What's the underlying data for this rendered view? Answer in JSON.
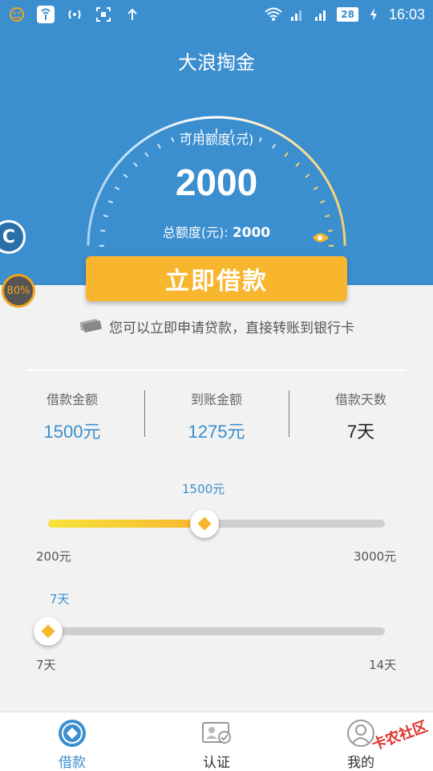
{
  "status_bar": {
    "battery": "28",
    "time": "16:03"
  },
  "header": {
    "title": "大浪掏金",
    "available_label": "可用额度(元)",
    "available_amount": "2000",
    "total_label": "总额度(元): ",
    "total_amount": "2000",
    "side_bubble": "C",
    "badge_percent": "80%"
  },
  "borrow_button": "立即借款",
  "tip": "您可以立即申请贷款，直接转账到银行卡",
  "stats": [
    {
      "label": "借款金额",
      "value": "1500元"
    },
    {
      "label": "到账金额",
      "value": "1275元"
    },
    {
      "label": "借款天数",
      "value": "7天"
    }
  ],
  "amount_slider": {
    "current": "1500元",
    "min": "200元",
    "max": "3000元",
    "value": 1500,
    "range": [
      200,
      3000
    ]
  },
  "days_slider": {
    "current": "7天",
    "min": "7天",
    "max": "14天",
    "value": 7,
    "range": [
      7,
      14
    ]
  },
  "bottom_nav": [
    {
      "label": "借款",
      "icon": "loan-icon",
      "active": true
    },
    {
      "label": "认证",
      "icon": "id-card-icon",
      "active": false
    },
    {
      "label": "我的",
      "icon": "user-icon",
      "active": false
    }
  ],
  "watermark": "卡农社区",
  "colors": {
    "primary": "#3b8fcf",
    "accent": "#f8b52e"
  }
}
